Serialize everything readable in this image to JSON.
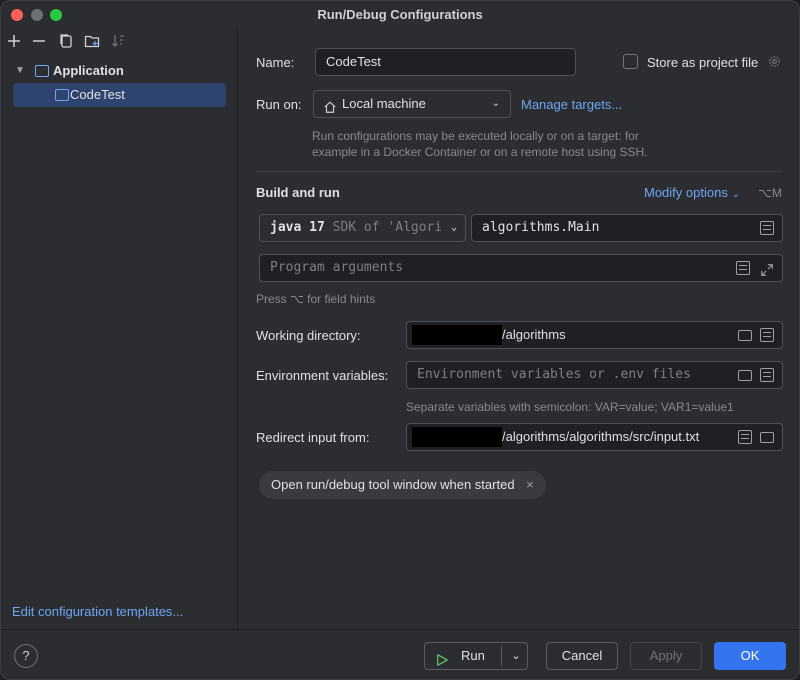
{
  "window": {
    "title": "Run/Debug Configurations"
  },
  "sidebar": {
    "tree": [
      {
        "label": "Application"
      },
      {
        "label": "CodeTest"
      }
    ],
    "edit_templates": "Edit configuration templates..."
  },
  "form": {
    "name_label": "Name:",
    "name_value": "CodeTest",
    "store_project_file": "Store as project file",
    "run_on_label": "Run on:",
    "run_on_value": "Local machine",
    "manage_targets": "Manage targets...",
    "run_on_hint_1": "Run configurations may be executed locally or on a target: for",
    "run_on_hint_2": "example in a Docker Container or on a remote host using SSH.",
    "build_and_run": "Build and run",
    "modify_options": "Modify options",
    "modify_shortcut": "⌥M",
    "jdk_version": "java 17",
    "jdk_desc": "SDK of 'Algori",
    "main_class": "algorithms.Main",
    "program_args_placeholder": "Program arguments",
    "field_hints": "Press ⌥ for field hints",
    "working_dir_label": "Working directory:",
    "working_dir_value": "/algorithms",
    "env_label": "Environment variables:",
    "env_placeholder": "Environment variables or .env files",
    "env_hint": "Separate variables with semicolon: VAR=value; VAR1=value1",
    "redirect_label": "Redirect input from:",
    "redirect_value": "/algorithms/algorithms/src/input.txt",
    "open_tool_window": "Open run/debug tool window when started"
  },
  "footer": {
    "help": "?",
    "run": "Run",
    "cancel": "Cancel",
    "apply": "Apply",
    "ok": "OK"
  },
  "colors": {
    "accent": "#3574f0",
    "link": "#6ea6f5",
    "selection": "#2e436e",
    "background": "#2b2d30"
  }
}
